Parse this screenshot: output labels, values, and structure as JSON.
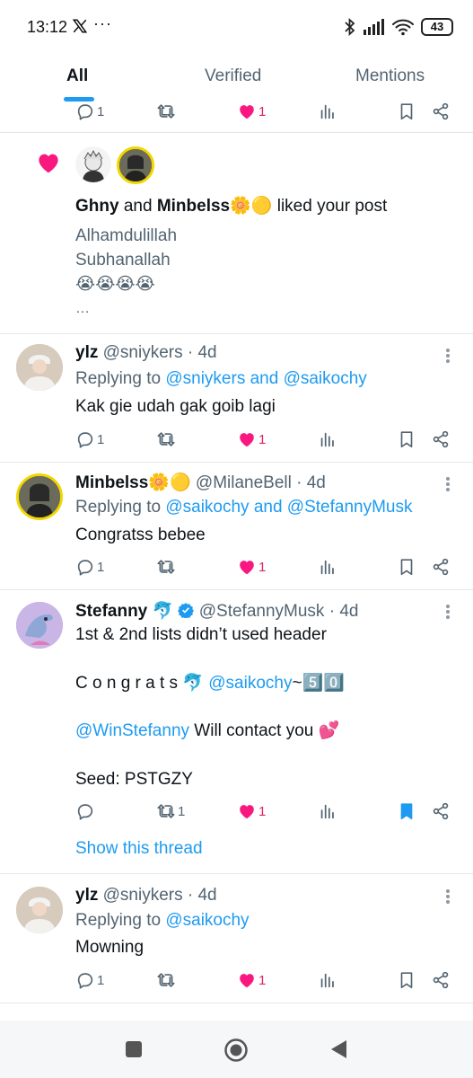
{
  "status": {
    "time": "13:12",
    "dots": "···",
    "battery": "43"
  },
  "tabs": [
    {
      "label": "All",
      "active": true
    },
    {
      "label": "Verified",
      "active": false
    },
    {
      "label": "Mentions",
      "active": false
    }
  ],
  "top_actions": {
    "reply_count": "1",
    "like_count": "1"
  },
  "like_notification": {
    "user1": "Ghny",
    "connector": "and",
    "user2": "Minbelss🌼🟡",
    "action": "liked your post",
    "post_lines": [
      "Alhamdulillah",
      "Subhanallah",
      "😭😭😭😭",
      "…"
    ]
  },
  "posts": [
    {
      "name": "ylz",
      "handle": "@sniykers · 4d",
      "replying_prefix": "Replying to",
      "replying_to": "@sniykers and @saikochy",
      "body": "Kak gie udah gak goib lagi",
      "reply_count": "1",
      "like_count": "1"
    },
    {
      "name": "Minbelss🌼🟡",
      "handle": "@MilaneBell · 4d",
      "replying_prefix": "Replying to",
      "replying_to": "@saikochy and @StefannyMusk",
      "body": "Congratss bebee",
      "reply_count": "1",
      "like_count": "1"
    },
    {
      "name": "Stefanny 🐬",
      "handle": "@StefannyMusk · 4d",
      "line1": "1st & 2nd lists didn’t used header",
      "line2_text": "C o n g r a t s 🐬",
      "line2_link": "@saikochy",
      "line2_tail": "~5️⃣0️⃣",
      "line3_link": "@WinStefanny",
      "line3_tail": "Will contact you 💕",
      "line4": "Seed: PSTGZY",
      "retweet_count": "1",
      "like_count": "1",
      "show_thread": "Show this thread"
    },
    {
      "name": "ylz",
      "handle": "@sniykers · 4d",
      "replying_prefix": "Replying to",
      "replying_to": "@saikochy",
      "body": "Mowning",
      "reply_count": "1",
      "like_count": "1"
    }
  ],
  "colors": {
    "accent": "#1d9bf0",
    "like": "#f91880",
    "muted": "#536471"
  }
}
